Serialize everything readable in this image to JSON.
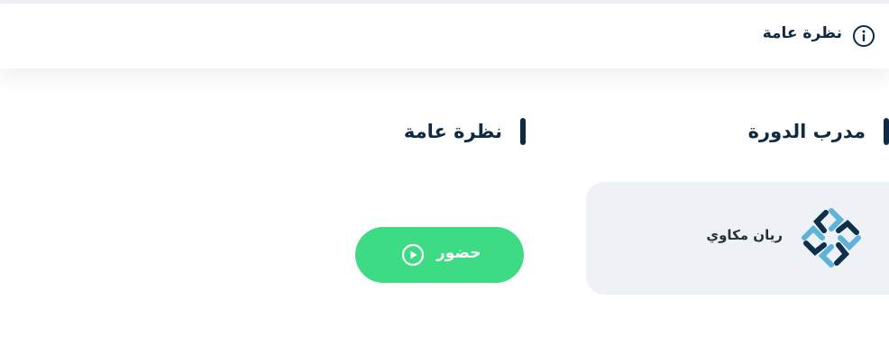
{
  "tabs": {
    "overview_label": "نظرة عامة",
    "overview_icon": "info-circle-icon"
  },
  "sections": {
    "trainer_title": "مدرب الدورة",
    "overview_title": "نظرة عامة"
  },
  "trainer": {
    "name": "ريان مكاوي",
    "logo_icon": "trainer-logo-icon"
  },
  "attend": {
    "label": "حضور",
    "icon": "play-circle-icon"
  },
  "colors": {
    "text_primary": "#0f2a44",
    "accent_green": "#3ddc84",
    "card_background": "#eef2f7",
    "logo_dark": "#0d2f4c",
    "logo_light": "#5fb3d9"
  }
}
